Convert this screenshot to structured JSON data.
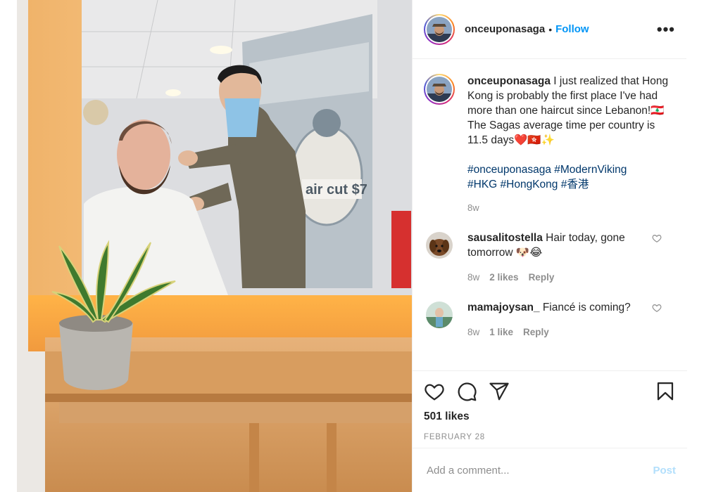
{
  "post": {
    "username": "onceuponasaga",
    "separator": "•",
    "follow_label": "Follow",
    "more_label": "•••",
    "photo_sign_text": "air cut $7"
  },
  "caption": {
    "username": "onceuponasaga",
    "text": " I just realized that Hong Kong is probably the first place I've had more than one haircut since Lebanon!🇱🇧 The Sagas average time per country is 11.5 days❤️🇭🇰✨",
    "hashtags": [
      "#onceuponasaga",
      "#ModernViking",
      "#HKG",
      "#HongKong",
      "#香港"
    ],
    "time": "8w"
  },
  "comments": [
    {
      "username": "sausalitostella",
      "text": " Hair today, gone tomorrow 🐶😂",
      "time": "8w",
      "likes": "2 likes",
      "reply_label": "Reply"
    },
    {
      "username": "mamajoysan_",
      "text": " Fiancé is coming?",
      "time": "8w",
      "likes": "1 like",
      "reply_label": "Reply"
    }
  ],
  "actions": {
    "icons": [
      "heart-icon",
      "comment-icon",
      "share-icon",
      "bookmark-icon"
    ],
    "likes_count": "501 likes",
    "date": "FEBRUARY 28"
  },
  "add_comment": {
    "placeholder": "Add a comment...",
    "post_label": "Post"
  },
  "colors": {
    "link_blue": "#0095f6",
    "hashtag_blue": "#00376b",
    "muted": "#8e8e8e",
    "post_disabled": "#b2dffc"
  }
}
